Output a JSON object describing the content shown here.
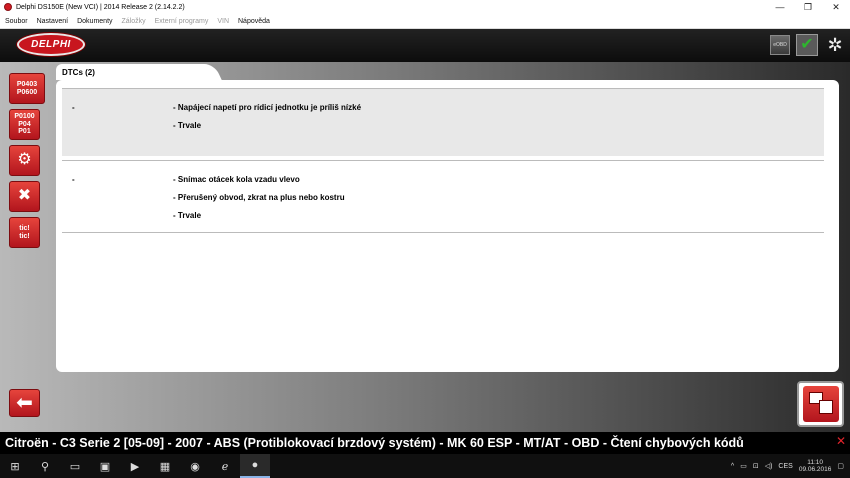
{
  "window": {
    "title": "Delphi DS150E (New VCI) | 2014 Release 2 (2.14.2.2)",
    "minimize": "—",
    "restore": "❐",
    "close": "✕"
  },
  "menu": [
    {
      "label": "Soubor",
      "disabled": false
    },
    {
      "label": "Nastavení",
      "disabled": false
    },
    {
      "label": "Dokumenty",
      "disabled": false
    },
    {
      "label": "Záložky",
      "disabled": true
    },
    {
      "label": "Externí programy",
      "disabled": true
    },
    {
      "label": "VIN",
      "disabled": true
    },
    {
      "label": "Nápověda",
      "disabled": false
    }
  ],
  "toolbar": {
    "logo": "DELPHI",
    "eobd_label": "eOBD"
  },
  "sidebar": {
    "btn1": "P0403\nP0600",
    "btn2": "P0100\nP04\nP01",
    "btn5": "tic!\ntic!"
  },
  "tab": {
    "label": "DTCs (2)"
  },
  "dtcs": [
    {
      "code": "-",
      "lines": [
        "- Napájecí napetí pro rídicí jednotku je príliš nízké",
        "- Trvale"
      ]
    },
    {
      "code": "-",
      "lines": [
        "- Snímac otácek kola vzadu vlevo",
        "- Přerušený obvod, zkrat na plus nebo kostru",
        "- Trvale"
      ]
    }
  ],
  "status": {
    "text": "Citroën - C3 Serie 2 [05-09] - 2007 - ABS (Protiblokovací brzdový systém) - MK 60 ESP - MT/AT - OBD - Čtení chybových kódů",
    "close": "✕"
  },
  "taskbar": {
    "language": "CES",
    "time": "11:10",
    "date": "09.06.2016"
  },
  "colors": {
    "brand_red": "#c8161e",
    "check_green": "#2fb52f"
  }
}
